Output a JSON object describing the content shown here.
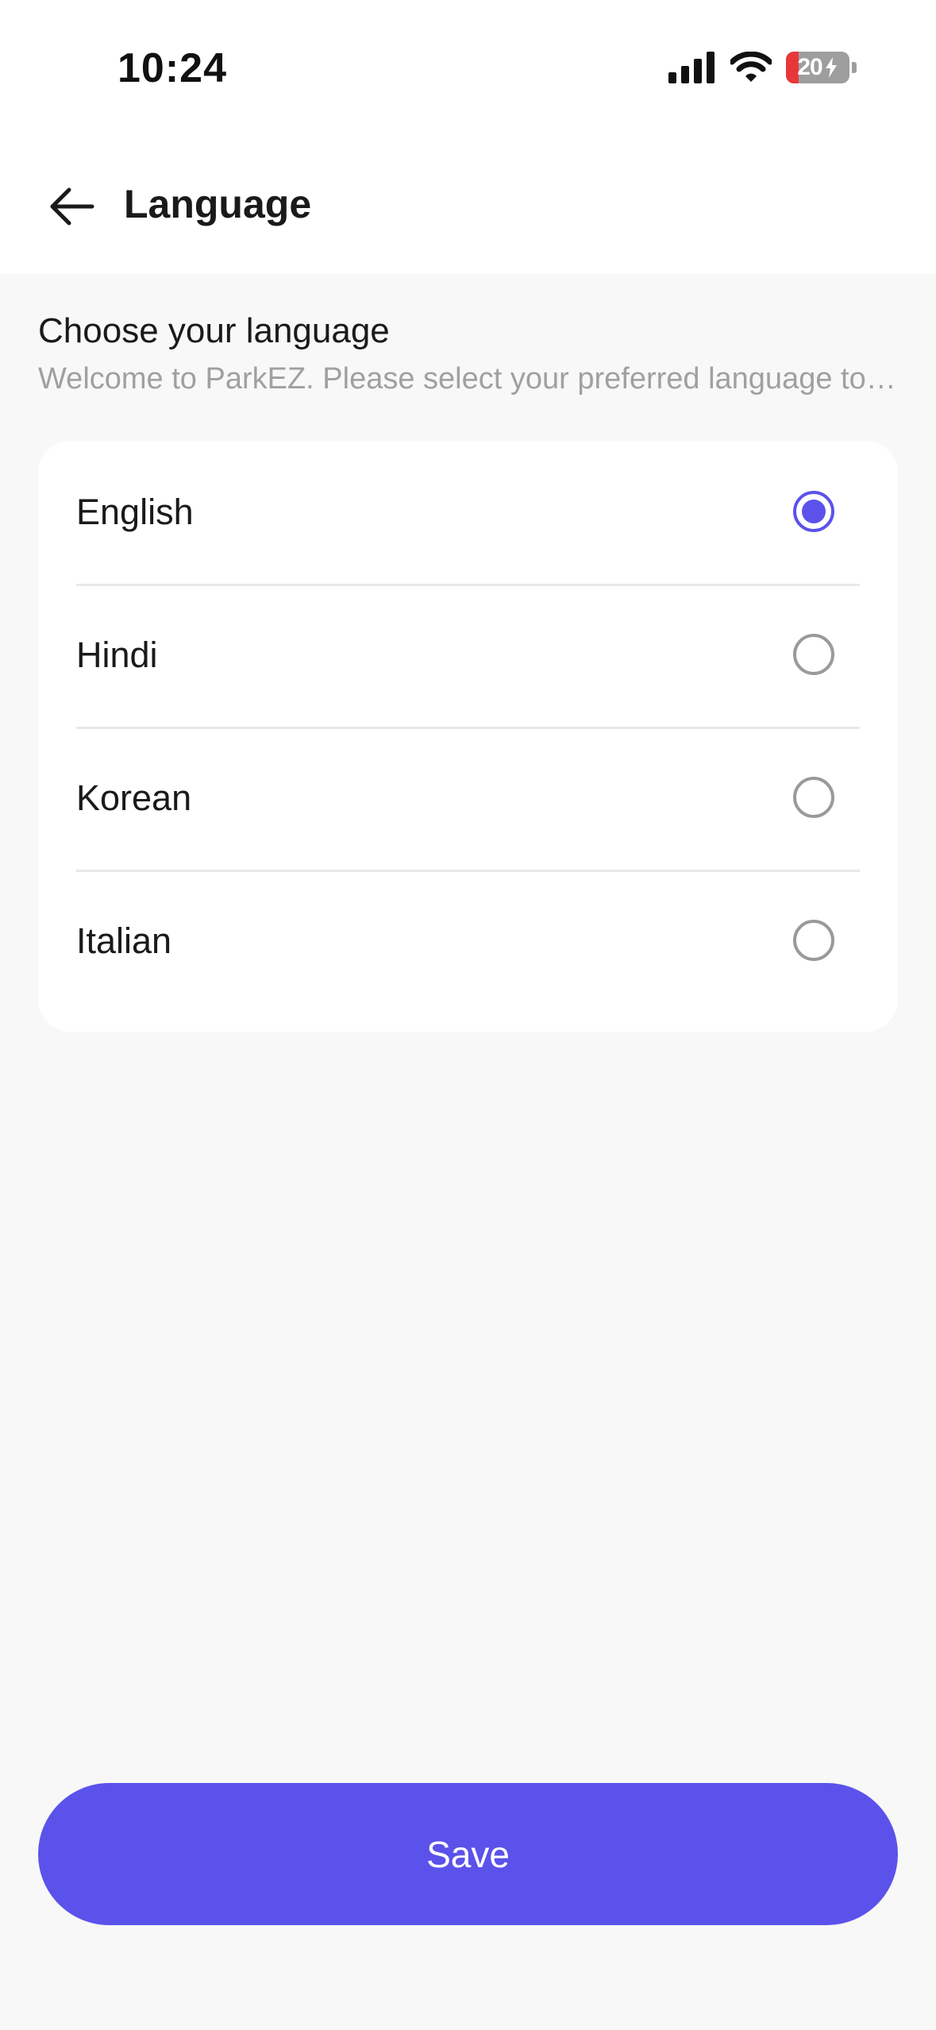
{
  "status_bar": {
    "time": "10:24",
    "battery_level": "20"
  },
  "header": {
    "title": "Language"
  },
  "section": {
    "title": "Choose your language",
    "subtitle": "Welcome to ParkEZ. Please select your preferred language to continue."
  },
  "languages": {
    "selected": "English",
    "items": [
      {
        "label": "English",
        "selected": true
      },
      {
        "label": "Hindi",
        "selected": false
      },
      {
        "label": "Korean",
        "selected": false
      },
      {
        "label": "Italian",
        "selected": false
      }
    ]
  },
  "actions": {
    "save_label": "Save"
  },
  "colors": {
    "accent": "#5b52eb",
    "battery_low": "#e8373b"
  },
  "icons": {
    "back": "arrow-left-icon",
    "signal": "cellular-signal-icon",
    "wifi": "wifi-icon",
    "battery": "battery-charging-icon"
  }
}
